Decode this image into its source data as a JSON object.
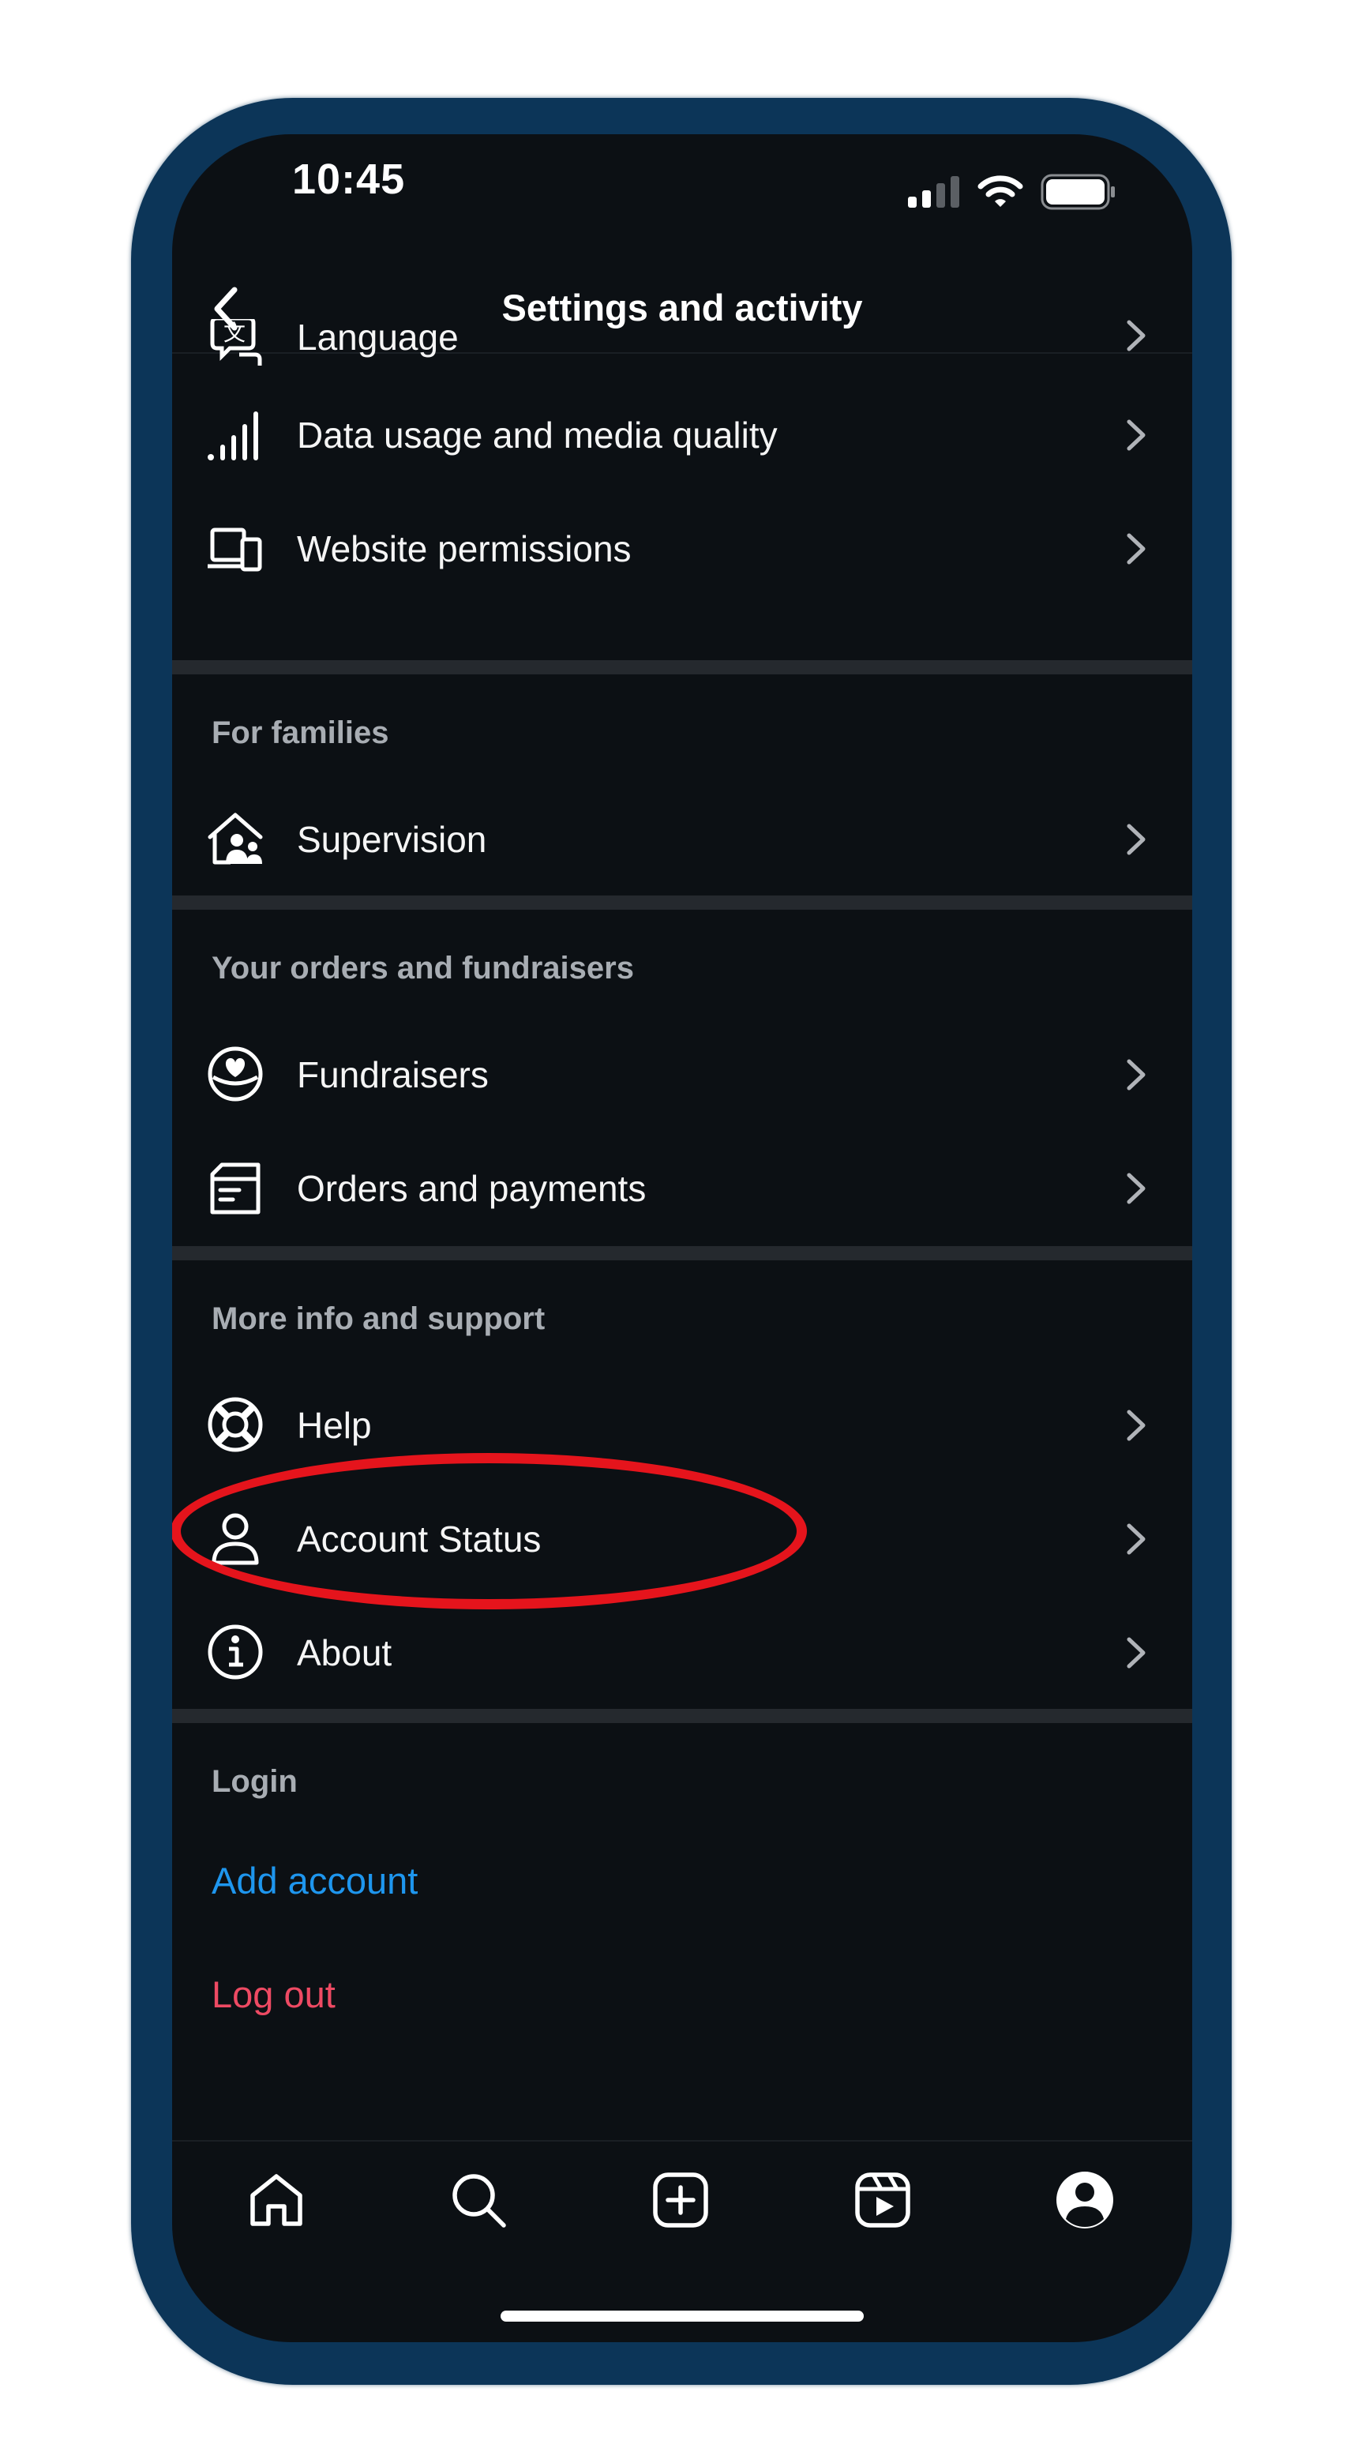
{
  "status_bar": {
    "time": "10:45",
    "icons": [
      "cellular-signal-icon",
      "wifi-icon",
      "battery-icon"
    ]
  },
  "header": {
    "title": "Settings and activity",
    "back_icon": "chevron-left-icon"
  },
  "sections": {
    "app_media": {
      "items": [
        {
          "label": "Language",
          "icon": "language-icon"
        },
        {
          "label": "Data usage and media quality",
          "icon": "signal-bars-icon"
        },
        {
          "label": "Website permissions",
          "icon": "devices-icon"
        }
      ]
    },
    "families": {
      "title": "For families",
      "items": [
        {
          "label": "Supervision",
          "icon": "family-home-icon"
        }
      ]
    },
    "orders": {
      "title": "Your orders and fundraisers",
      "items": [
        {
          "label": "Fundraisers",
          "icon": "heart-coin-icon"
        },
        {
          "label": "Orders and payments",
          "icon": "receipt-box-icon"
        }
      ]
    },
    "support": {
      "title": "More info and support",
      "items": [
        {
          "label": "Help",
          "icon": "lifebuoy-icon"
        },
        {
          "label": "Account Status",
          "icon": "person-icon"
        },
        {
          "label": "About",
          "icon": "info-icon"
        }
      ]
    },
    "login": {
      "title": "Login",
      "add_account": "Add account",
      "log_out": "Log out"
    }
  },
  "bottom_nav": [
    "home-icon",
    "search-icon",
    "create-post-icon",
    "reels-icon",
    "profile-icon"
  ],
  "colors": {
    "frame": "#0c3558",
    "background": "#0c1014",
    "link_blue": "#1e96ee",
    "logout_red": "#ee4a63",
    "highlight_red": "#e5141c"
  }
}
